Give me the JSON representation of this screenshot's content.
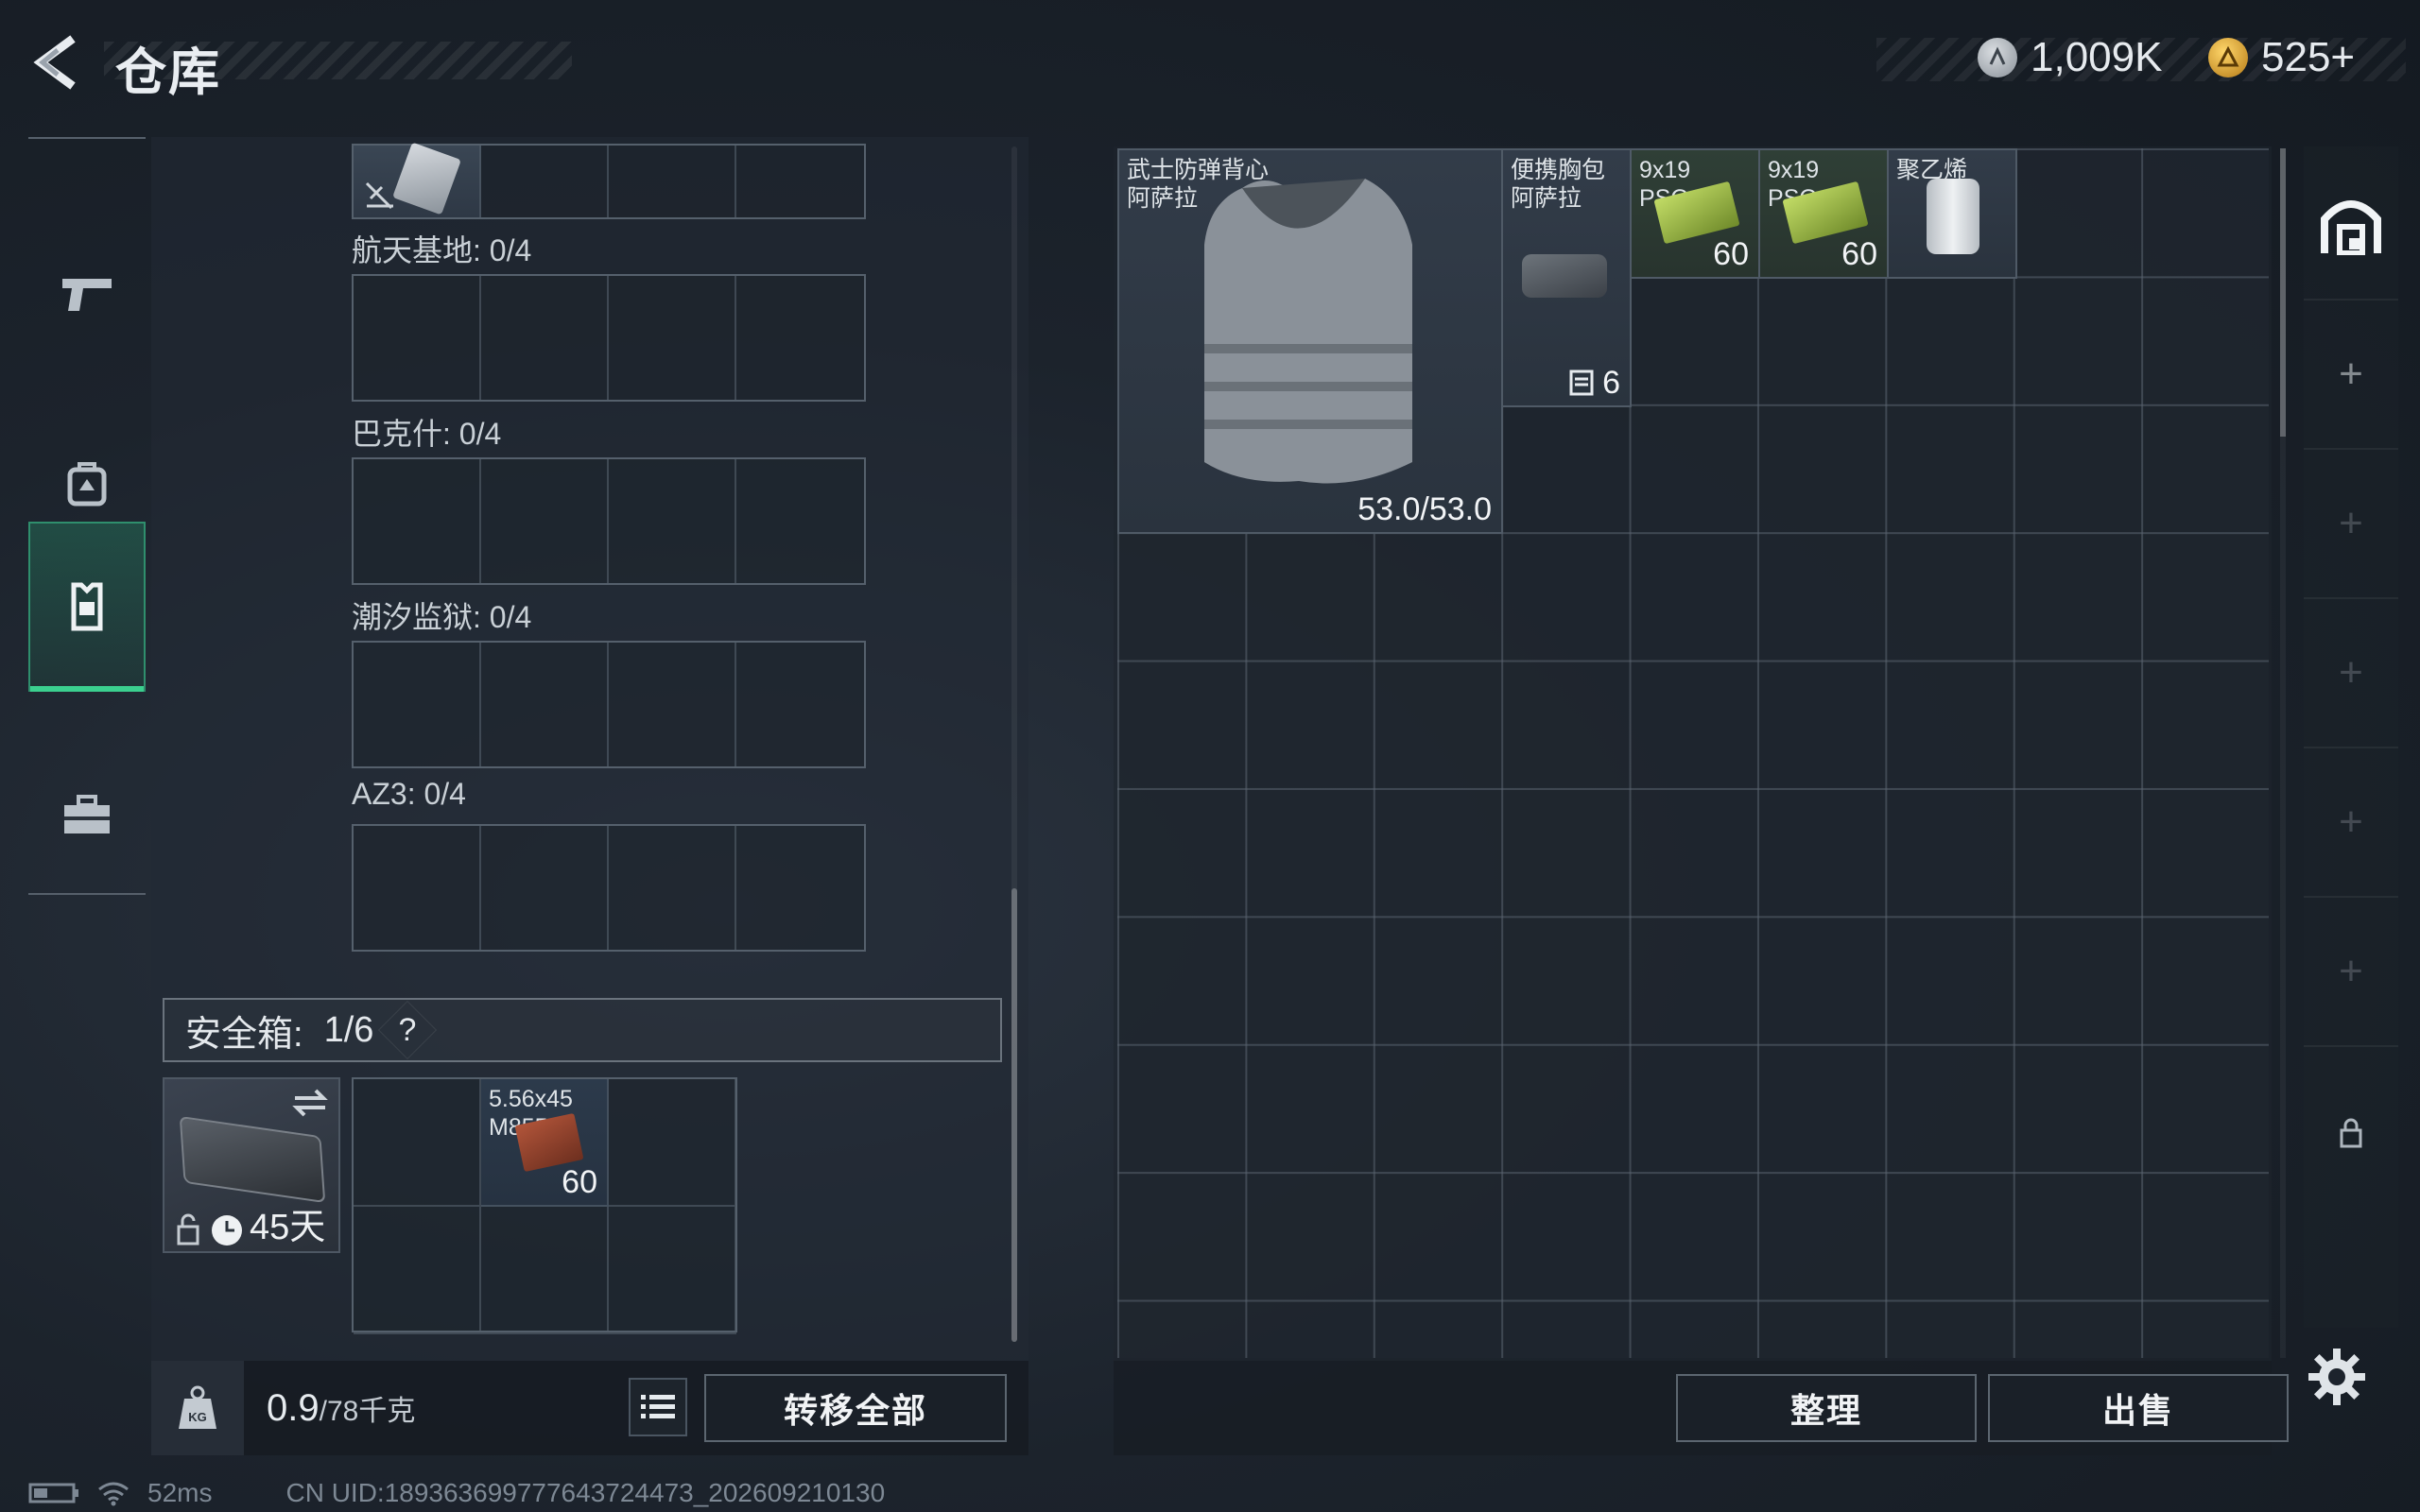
{
  "header": {
    "title": "仓库",
    "currency_silver": "1,009K",
    "currency_gold": "525+"
  },
  "nav": {
    "items": [
      {
        "icon": "pistol-icon"
      },
      {
        "icon": "backpack-icon"
      },
      {
        "icon": "vest-icon",
        "active": true
      },
      {
        "icon": "toolbox-icon"
      }
    ]
  },
  "left": {
    "sections": [
      {
        "label": "航天基地: 0/4"
      },
      {
        "label": "巴克什: 0/4"
      },
      {
        "label": "潮汐监狱: 0/4"
      },
      {
        "label": "AZ3: 0/4"
      }
    ],
    "safe_box": {
      "label": "安全箱:",
      "count": "1/6",
      "help": "?",
      "duration": "45天",
      "item": {
        "name": "5.56x45\nM855",
        "qty": "60"
      }
    },
    "weight": {
      "value": "0.9",
      "capacity": "/78千克"
    },
    "transfer_all": "转移全部"
  },
  "storage": {
    "items": [
      {
        "name": "武士防弹背心\n阿萨拉",
        "durability": "53.0/53.0"
      },
      {
        "name": "便携胸包\n阿萨拉",
        "slots": "6"
      },
      {
        "name": "9x19\nPSO",
        "qty": "60"
      },
      {
        "name": "9x19\nPSO",
        "qty": "60"
      },
      {
        "name": "聚乙烯"
      }
    ],
    "sort": "整理",
    "sell": "出售"
  },
  "status": {
    "ping": "52ms",
    "uid": "CN UID:189363699777643724473_202609210130"
  }
}
